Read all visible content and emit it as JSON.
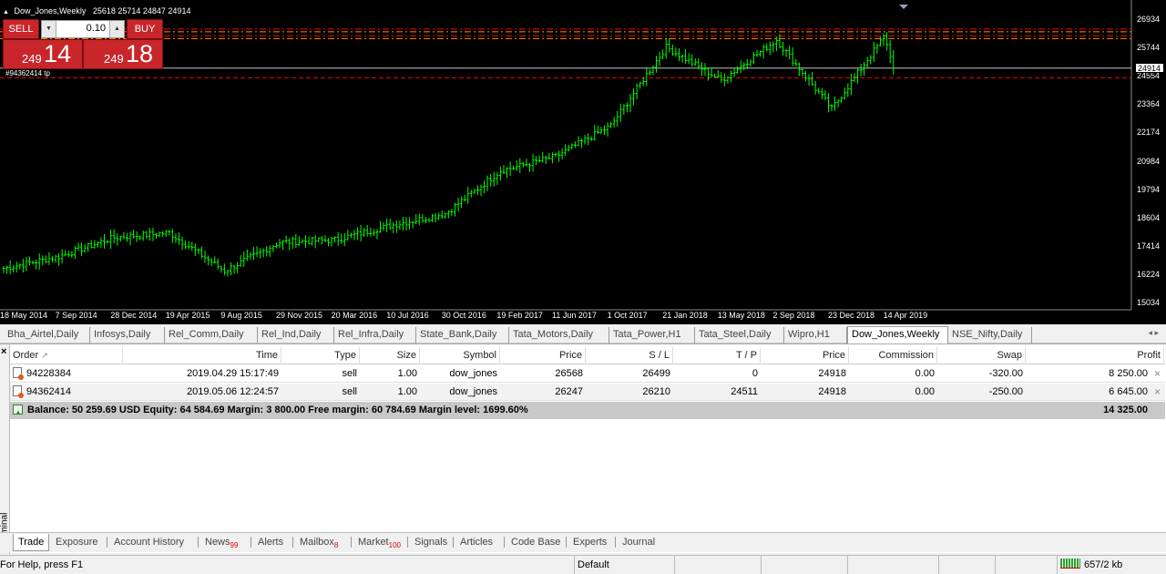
{
  "chart": {
    "header_symbol": "Dow_Jones,Weekly",
    "header_ohlc": "25618 25714 24847 24914",
    "sell_label": "SELL",
    "buy_label": "BUY",
    "lot_value": "0.10",
    "sell_price_small": "249",
    "sell_price_big": "14",
    "buy_price_small": "249",
    "buy_price_big": "18",
    "order_line_label": "#94362414 tp",
    "current_price": "24914",
    "y_ticks": [
      "26934",
      "25744",
      "24554",
      "23364",
      "22174",
      "20984",
      "19794",
      "18604",
      "17414",
      "16224",
      "15034"
    ],
    "x_ticks": [
      "18 May 2014",
      "7 Sep 2014",
      "28 Dec 2014",
      "19 Apr 2015",
      "9 Aug 2015",
      "29 Nov 2015",
      "20 Mar 2016",
      "10 Jul 2016",
      "30 Oct 2016",
      "19 Feb 2017",
      "11 Jun 2017",
      "1 Oct 2017",
      "21 Jan 2018",
      "13 May 2018",
      "2 Sep 2018",
      "23 Dec 2018",
      "14 Apr 2019"
    ],
    "colors": {
      "background": "#000000",
      "bars": "#00ff00",
      "sl_line": "#ff0000",
      "tp_line": "#ff8c00",
      "bid_line": "#c0c0c0"
    }
  },
  "chart_data": {
    "type": "bar",
    "title": "Dow_Jones,Weekly",
    "ylim": [
      15034,
      26934
    ],
    "y_ticks": [
      26934,
      25744,
      24554,
      23364,
      22174,
      20984,
      19794,
      18604,
      17414,
      16224,
      15034
    ],
    "x_ticks": [
      "18 May 2014",
      "7 Sep 2014",
      "28 Dec 2014",
      "19 Apr 2015",
      "9 Aug 2015",
      "29 Nov 2015",
      "20 Mar 2016",
      "10 Jul 2016",
      "30 Oct 2016",
      "19 Feb 2017",
      "11 Jun 2017",
      "1 Oct 2017",
      "21 Jan 2018",
      "13 May 2018",
      "2 Sep 2018",
      "23 Dec 2018",
      "14 Apr 2019"
    ],
    "close_at_ticks": [
      16500,
      17000,
      17800,
      18000,
      16400,
      17600,
      17700,
      18300,
      18800,
      20600,
      21200,
      22500,
      25800,
      24400,
      26100,
      23200,
      26400
    ],
    "last_close": 24914,
    "horizontal_lines": {
      "bid": 24914,
      "sl_levels": [
        26499,
        26210
      ],
      "tp_level": 24511
    },
    "grid": false
  },
  "symbol_tabs": [
    {
      "label": "Bha_Airtel,Daily",
      "active": false
    },
    {
      "label": "Infosys,Daily",
      "active": false
    },
    {
      "label": "Rel_Comm,Daily",
      "active": false
    },
    {
      "label": "Rel_Ind,Daily",
      "active": false
    },
    {
      "label": "Rel_Infra,Daily",
      "active": false
    },
    {
      "label": "State_Bank,Daily",
      "active": false
    },
    {
      "label": "Tata_Motors,Daily",
      "active": false
    },
    {
      "label": "Tata_Power,H1",
      "active": false
    },
    {
      "label": "Tata_Steel,Daily",
      "active": false
    },
    {
      "label": "Wipro,H1",
      "active": false
    },
    {
      "label": "Dow_Jones,Weekly",
      "active": true
    },
    {
      "label": "NSE_Nifty,Daily",
      "active": false
    }
  ],
  "terminal": {
    "side_label": "Terminal",
    "columns": [
      "Order",
      "Time",
      "Type",
      "Size",
      "Symbol",
      "Price",
      "S / L",
      "T / P",
      "Price",
      "Commission",
      "Swap",
      "Profit"
    ],
    "rows": [
      {
        "order": "94228384",
        "time": "2019.04.29 15:17:49",
        "type": "sell",
        "size": "1.00",
        "symbol": "dow_jones",
        "price": "26568",
        "sl": "26499",
        "tp": "0",
        "cur_price": "24918",
        "commission": "0.00",
        "swap": "-320.00",
        "profit": "8 250.00"
      },
      {
        "order": "94362414",
        "time": "2019.05.06 12:24:57",
        "type": "sell",
        "size": "1.00",
        "symbol": "dow_jones",
        "price": "26247",
        "sl": "26210",
        "tp": "24511",
        "cur_price": "24918",
        "commission": "0.00",
        "swap": "-250.00",
        "profit": "6 645.00"
      }
    ],
    "summary": "Balance: 50 259.69 USD  Equity: 64 584.69  Margin: 3 800.00  Free margin: 60 784.69  Margin level: 1699.60%",
    "summary_profit": "14 325.00"
  },
  "bottom_tabs": [
    {
      "label": "Trade",
      "badge": "",
      "active": true
    },
    {
      "label": "Exposure",
      "badge": "",
      "active": false
    },
    {
      "label": "Account History",
      "badge": "",
      "active": false
    },
    {
      "label": "News",
      "badge": "99",
      "active": false
    },
    {
      "label": "Alerts",
      "badge": "",
      "active": false
    },
    {
      "label": "Mailbox",
      "badge": "8",
      "active": false
    },
    {
      "label": "Market",
      "badge": "100",
      "active": false
    },
    {
      "label": "Signals",
      "badge": "",
      "active": false
    },
    {
      "label": "Articles",
      "badge": "",
      "active": false
    },
    {
      "label": "Code Base",
      "badge": "",
      "active": false
    },
    {
      "label": "Experts",
      "badge": "",
      "active": false
    },
    {
      "label": "Journal",
      "badge": "",
      "active": false
    }
  ],
  "status": {
    "help": "For Help, press F1",
    "profile": "Default",
    "traffic": "657/2 kb"
  }
}
